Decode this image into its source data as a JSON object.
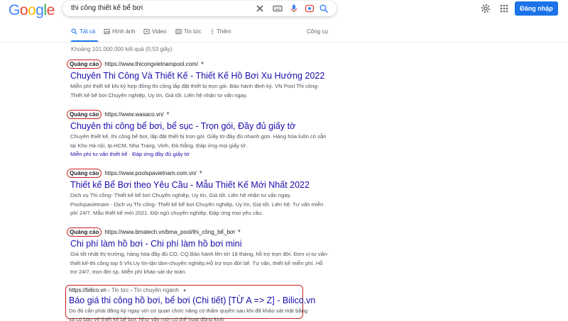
{
  "header": {
    "logo": "Google",
    "search_query": "thi công thiết kế bể bơi",
    "signin_label": "Đăng nhập"
  },
  "tabs": [
    {
      "label": "Tất cả",
      "icon": "search-icon",
      "active": true
    },
    {
      "label": "Hình ảnh",
      "icon": "image-icon"
    },
    {
      "label": "Video",
      "icon": "video-icon"
    },
    {
      "label": "Tin tức",
      "icon": "news-icon"
    },
    {
      "label": "Thêm",
      "icon": "more-icon"
    }
  ],
  "tools_label": "Công cụ",
  "stats": "Khoảng 101.000.000 kết quả (0,53 giây)",
  "ad_badge": "Quảng cáo",
  "ads": [
    {
      "url": "https://www.thicongvietnampool.com/",
      "title": "Chuyên Thi Công Và Thiết Kế - Thiết Kế Hồ Bơi Xu Hướng 2022",
      "desc": "Miễn phí thiết kế khi ký hợp đồng thi công lắp đặt thiết bị trọn gói. Bảo hành định kỳ. VN Pool Thi công- Thiết kế bể bơi Chuyên nghiệp, Uy tín, Giá tốt. Liên hệ nhận tư vấn ngay."
    },
    {
      "url": "https://www.wasaco.vn/",
      "title": "Chuyên thi công bể bơi, bể sục - Trọn gói, Đầy đủ giấy tờ",
      "desc": "Chuyên thiết kế, thi công bể bơi, lắp đặt thiết bị trọn gói. Giấy tờ đầy đủ nhanh gọn. Hàng hóa luôn có sẵn tại Kho Hà nội, tp.HCM, Nha Trang, Vinh, Đà Nẵng. Đáp ứng mọi giấy tờ.",
      "sitelinks": "Miễn phí tư vấn thiết kế · Đáp ứng đầy đủ giấy tờ"
    },
    {
      "url": "https://www.poolspavietnam.com.vn/",
      "title": "Thiết kế Bể Bơi theo Yêu Cầu - Mẫu Thiết Kế Mới Nhất 2022",
      "desc": "Dịch vụ Thi công- Thiết kế bể bơi Chuyên nghiệp, Uy tín, Giá tốt. Liên hệ nhận tư vấn ngay. Poolspavietnam - Dịch vụ Thi công- Thiết kế bể bơi Chuyên nghiệp, Uy tín, Giá tốt. Liên hệ. Tư vấn miễn phí 24/7. Mẫu thiết kế mới 2021. Đội ngũ chuyên nghiệp. Đáp ứng mọi yêu cầu."
    },
    {
      "url": "https://www.bmatech.vn/bma_pool/thi_công_bể_bơi",
      "title": "Chi phí làm hồ bơi - Chi phí làm hồ bơi mini",
      "desc": "Giá tốt nhất thị trường, hàng hóa đầy đủ CO, CQ.Bảo hành lên tới 18 tháng, hỗ trợ trọn đời. Đơn vị tư vấn-thiết kế-thi công top 5 VN.Uy tín-tận tâm-chuyên nghiệp.Hỗ trợ trọn đời bể. Tư vấn, thiết kế miễn phí. Hỗ trợ 24/7, trọn đời sp. Miễn phí khảo sát dự toán."
    }
  ],
  "organic": {
    "url": "https://bilico.vn",
    "crumb": "› Tin tức › Tin chuyên ngành",
    "title": "Báo giá thi công hồ bơi, bể bơi (Chi tiết) [TỪ A => Z] - Bilico.vn",
    "desc": "Do đó cần phải đăng ký ngay với cơ quan chức năng có thẩm quyền sau khi đã khảo sát mặt bằng và có bản vẽ thiết kế bể bơi. Như vậy mới có thể hoạt động kinh"
  },
  "colors": {
    "link": "#1a0dab",
    "accent": "#1a73e8",
    "highlight": "#c5221f"
  }
}
